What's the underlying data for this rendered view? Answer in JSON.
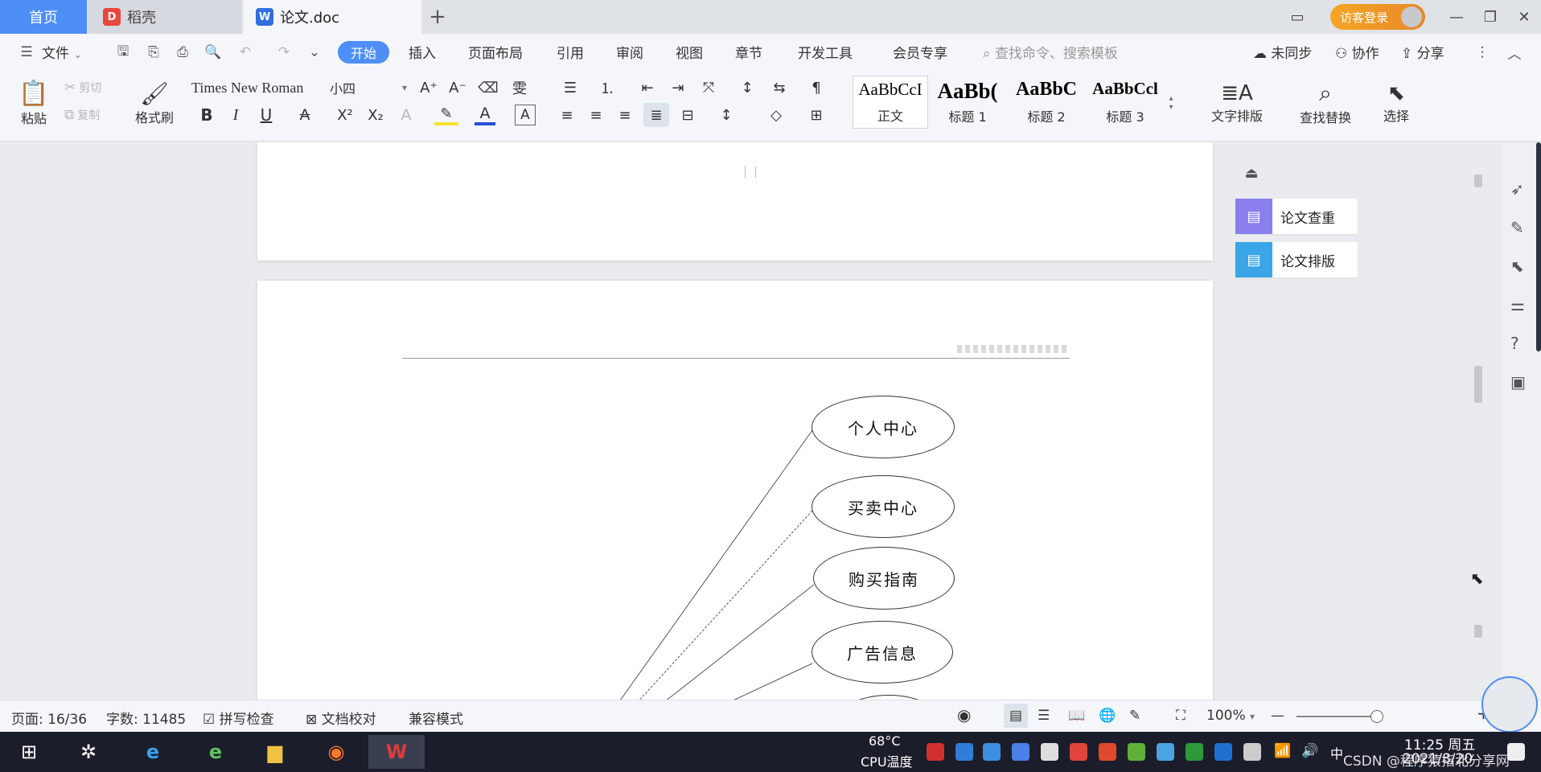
{
  "tabs": {
    "home": "首页",
    "daoke": "稻壳",
    "doc": "论文.doc",
    "add": "+"
  },
  "window": {
    "vip": "访客登录"
  },
  "menu": {
    "file": "文件",
    "items": [
      "开始",
      "插入",
      "页面布局",
      "引用",
      "审阅",
      "视图",
      "章节",
      "开发工具",
      "会员专享"
    ],
    "search_placeholder": "查找命令、搜索模板",
    "sync": "未同步",
    "collab": "协作",
    "share": "分享"
  },
  "ribbon": {
    "paste": "粘贴",
    "cut": "剪切",
    "copy": "复制",
    "format_painter": "格式刷",
    "font_name": "Times New Roman",
    "font_size": "小四",
    "styles": [
      {
        "sample": "AaBbCcI",
        "name": "正文"
      },
      {
        "sample": "AaBb(",
        "name": "标题 1"
      },
      {
        "sample": "AaBbC",
        "name": "标题 2"
      },
      {
        "sample": "AaBbCcl",
        "name": "标题 3"
      }
    ],
    "text_layout": "文字排版",
    "find_replace": "查找替换",
    "select": "选择"
  },
  "side_panel": {
    "thesis_check": "论文查重",
    "thesis_format": "论文排版"
  },
  "document": {
    "diagram_nodes": [
      "个人中心",
      "买卖中心",
      "购买指南",
      "广告信息"
    ]
  },
  "status": {
    "page": "页面: 16/36",
    "words": "字数: 11485",
    "spell": "拼写检查",
    "proof": "文档校对",
    "compat": "兼容模式",
    "zoom": "100%"
  },
  "taskbar": {
    "cpu_temp": "68°C",
    "cpu_label": "CPU温度",
    "ime": "中",
    "time": "11:25 周五",
    "date": "2021/8/20",
    "watermark": "CSDN @程序猿指北分享网"
  },
  "colors": {
    "accent": "#4e8ef7",
    "vip": "#f5a623",
    "taskbar": "#1b1e2a"
  }
}
